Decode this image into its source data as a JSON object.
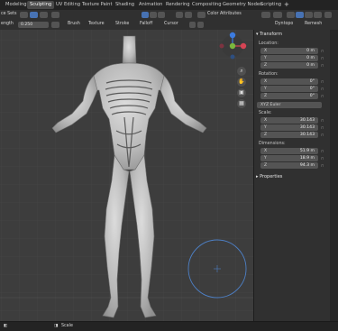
{
  "topbar": {
    "workspace_tabs": [
      {
        "label": "Modeling",
        "active": false
      },
      {
        "label": "Sculpting",
        "active": true
      },
      {
        "label": "UV Editing",
        "active": false
      },
      {
        "label": "Texture Paint",
        "active": false
      },
      {
        "label": "Shading",
        "active": false
      },
      {
        "label": "Animation",
        "active": false
      },
      {
        "label": "Rendering",
        "active": false
      },
      {
        "label": "Compositing",
        "active": false
      },
      {
        "label": "Geometry Nodes",
        "active": false
      },
      {
        "label": "Scripting",
        "active": false
      }
    ],
    "add_tab_label": "+"
  },
  "header": {
    "face_sets_label": "ce Sets",
    "color_attributes_label": "Color Attributes"
  },
  "tool_settings": {
    "strength_label": "ength",
    "strength_value": "0.250",
    "brush_label": "Brush",
    "texture_label": "Texture",
    "stroke_label": "Stroke",
    "falloff_label": "Falloff",
    "cursor_label": "Cursor",
    "dyntopo_label": "Dyntopo",
    "remesh_label": "Remesh"
  },
  "gizmo": {
    "x": "X",
    "y": "Y",
    "z": "Z"
  },
  "npanel": {
    "transform_title": "Transform",
    "location_label": "Location:",
    "location": [
      {
        "axis": "X",
        "value": "0 m"
      },
      {
        "axis": "Y",
        "value": "0 m"
      },
      {
        "axis": "Z",
        "value": "0 m"
      }
    ],
    "rotation_label": "Rotation:",
    "rotation": [
      {
        "axis": "X",
        "value": "0°"
      },
      {
        "axis": "Y",
        "value": "0°"
      },
      {
        "axis": "Z",
        "value": "0°"
      }
    ],
    "euler_mode": "XYZ Euler",
    "scale_label": "Scale:",
    "scale": [
      {
        "axis": "X",
        "value": "30.143"
      },
      {
        "axis": "Y",
        "value": "30.143"
      },
      {
        "axis": "Z",
        "value": "30.143"
      }
    ],
    "dimensions_label": "Dimensions:",
    "dimensions": [
      {
        "axis": "X",
        "value": "51.9 m"
      },
      {
        "axis": "Y",
        "value": "18.9 m"
      },
      {
        "axis": "Z",
        "value": "94.3 m"
      }
    ],
    "properties_title": "Properties"
  },
  "statusbar": {
    "scale_label": "Scale"
  },
  "colors": {
    "accent_blue": "#4772b3",
    "x_axis": "#d64454",
    "y_axis": "#7ab83d",
    "z_axis": "#3c7ce0",
    "brush_circle": "#4d7fc4"
  }
}
